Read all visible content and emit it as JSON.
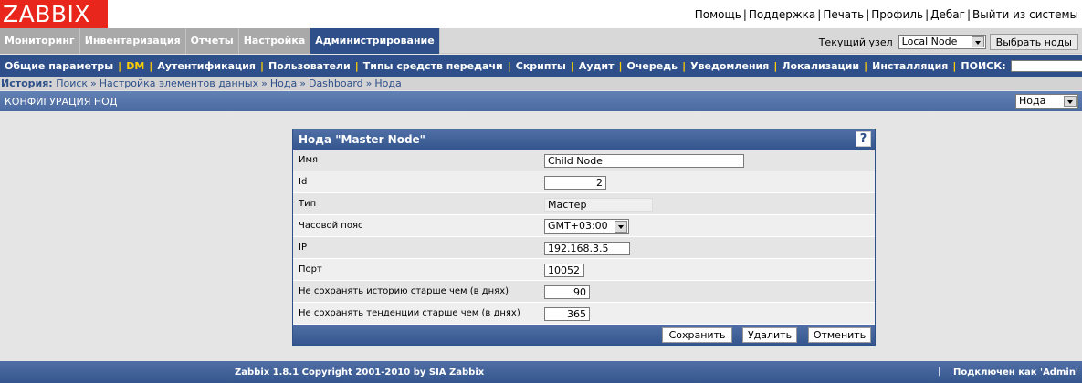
{
  "logo": "ZABBIX",
  "toplinks": [
    "Помощь",
    "Поддержка",
    "Печать",
    "Профиль",
    "Дебаг",
    "Выйти из системы"
  ],
  "mainmenu": {
    "items": [
      "Мониторинг",
      "Инвентаризация",
      "Отчеты",
      "Настройка",
      "Администрирование"
    ],
    "active": "Администрирование",
    "node_label": "Текущий узел",
    "node_value": "Local Node",
    "select_nodes_button": "Выбрать ноды"
  },
  "submenu": {
    "items": [
      "Общие параметры",
      "DM",
      "Аутентификация",
      "Пользователи",
      "Типы средств передачи",
      "Скрипты",
      "Аудит",
      "Очередь",
      "Уведомления",
      "Локализации",
      "Инсталляция"
    ],
    "active": "DM",
    "search_label": "ПОИСК:",
    "search_value": ""
  },
  "history": {
    "label": "История:",
    "items": [
      "Поиск",
      "Настройка элементов данных",
      "Нода",
      "Dashboard",
      "Нода"
    ]
  },
  "page": {
    "title": "КОНФИГУРАЦИЯ НОД",
    "select_value": "Нода"
  },
  "form": {
    "title": "Нода \"Master Node\"",
    "help": "?",
    "fields": [
      {
        "label": "Имя",
        "value": "Child Node"
      },
      {
        "label": "Id",
        "value": "2"
      },
      {
        "label": "Тип",
        "value": "Мастер"
      },
      {
        "label": "Часовой пояс",
        "value": "GMT+03:00"
      },
      {
        "label": "IP",
        "value": "192.168.3.5"
      },
      {
        "label": "Порт",
        "value": "10052"
      },
      {
        "label": "Не сохранять историю старше чем (в днях)",
        "value": "90"
      },
      {
        "label": "Не сохранять тенденции старше чем (в днях)",
        "value": "365"
      }
    ],
    "buttons": {
      "save": "Сохранить",
      "delete": "Удалить",
      "cancel": "Отменить"
    }
  },
  "footer": {
    "copyright": "Zabbix 1.8.1 Copyright 2001-2010 by SIA Zabbix",
    "connected": "Подключен как 'Admin'",
    "separator": "|"
  },
  "colors": {
    "brand": "#e8261b",
    "nav": "#2e4f8a",
    "active_sub": "#ffce00"
  }
}
